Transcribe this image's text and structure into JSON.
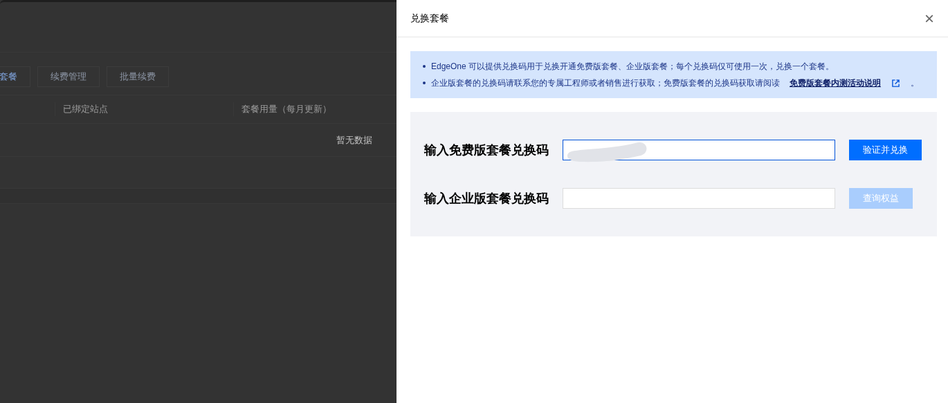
{
  "background_page": {
    "buttons": [
      {
        "label": "套餐",
        "primary": true
      },
      {
        "label": "续费管理",
        "primary": false
      },
      {
        "label": "批量续费",
        "primary": false
      }
    ],
    "table": {
      "columns": [
        "已绑定站点",
        "套餐用量（每月更新）"
      ],
      "empty_text": "暂无数据"
    }
  },
  "dialog": {
    "title": "兑换套餐",
    "close_icon": "×",
    "notice": [
      {
        "text": "EdgeOne 可以提供兑换码用于兑换开通免费版套餐、企业版套餐；每个兑换码仅可使用一次，兑换一个套餐。"
      },
      {
        "text": "企业版套餐的兑换码请联系您的专属工程师或者销售进行获取；免费版套餐的兑换码获取请阅读",
        "link": "免费版套餐内测活动说明",
        "after": "。"
      }
    ],
    "rows": [
      {
        "label": "输入免费版套餐兑换码",
        "focused": true,
        "redacted": true,
        "button": "验证并兑换",
        "disabled": false
      },
      {
        "label": "输入企业版套餐兑换码",
        "focused": false,
        "redacted": false,
        "button": "查询权益",
        "disabled": true
      }
    ]
  }
}
